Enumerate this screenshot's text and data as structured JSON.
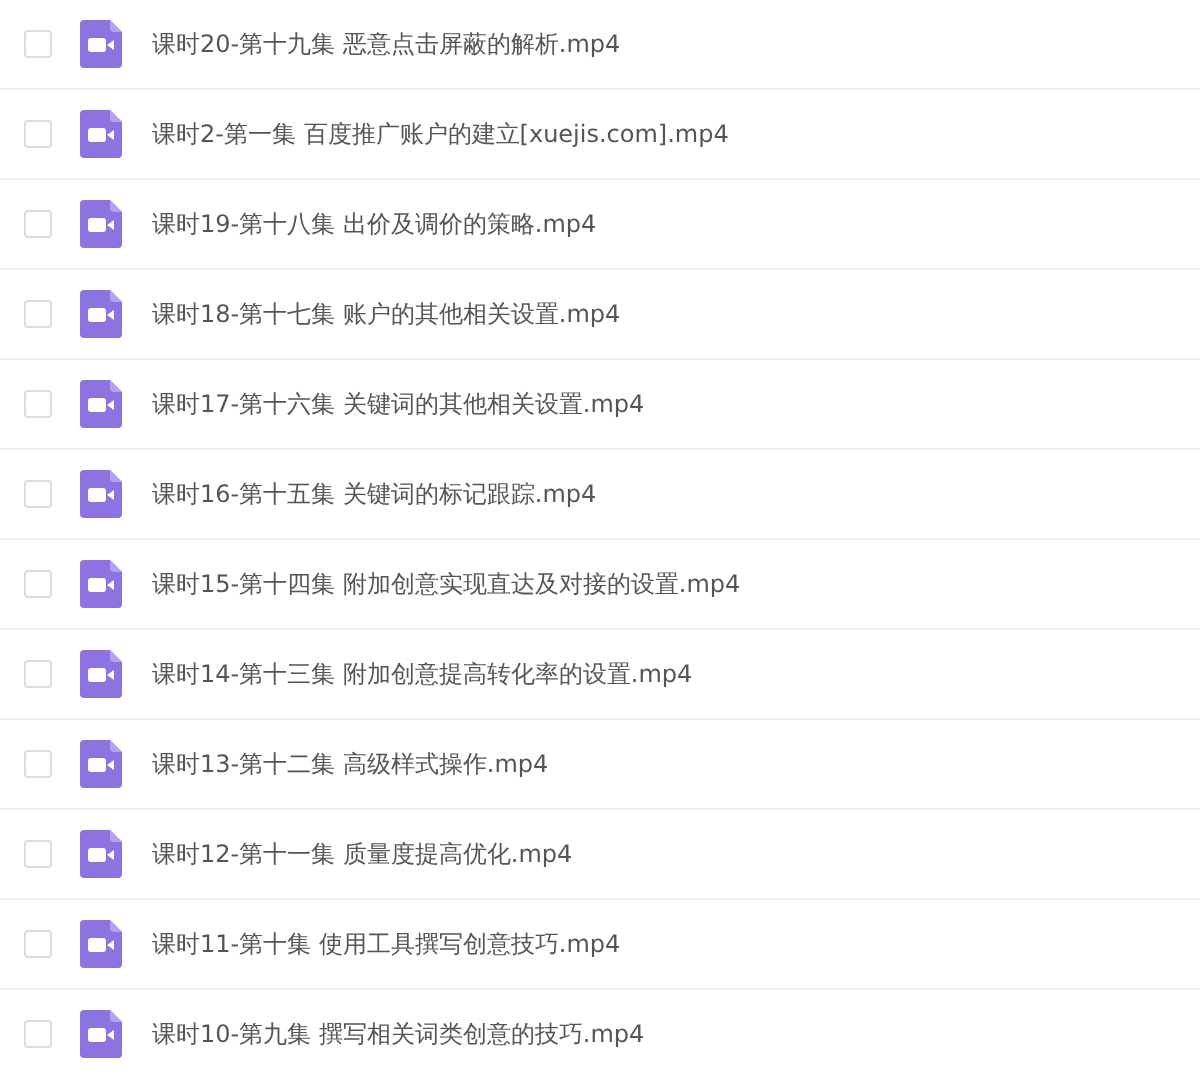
{
  "files": [
    {
      "name": "课时20-第十九集 恶意点击屏蔽的解析.mp4",
      "checked": false
    },
    {
      "name": "课时2-第一集 百度推广账户的建立[xuejis.com].mp4",
      "checked": false
    },
    {
      "name": "课时19-第十八集 出价及调价的策略.mp4",
      "checked": false
    },
    {
      "name": "课时18-第十七集 账户的其他相关设置.mp4",
      "checked": false
    },
    {
      "name": "课时17-第十六集 关键词的其他相关设置.mp4",
      "checked": false
    },
    {
      "name": "课时16-第十五集 关键词的标记跟踪.mp4",
      "checked": false
    },
    {
      "name": "课时15-第十四集 附加创意实现直达及对接的设置.mp4",
      "checked": false
    },
    {
      "name": "课时14-第十三集 附加创意提高转化率的设置.mp4",
      "checked": false
    },
    {
      "name": "课时13-第十二集 高级样式操作.mp4",
      "checked": false
    },
    {
      "name": "课时12-第十一集 质量度提高优化.mp4",
      "checked": false
    },
    {
      "name": "课时11-第十集 使用工具撰写创意技巧.mp4",
      "checked": false
    },
    {
      "name": "课时10-第九集 撰写相关词类创意的技巧.mp4",
      "checked": false
    }
  ]
}
